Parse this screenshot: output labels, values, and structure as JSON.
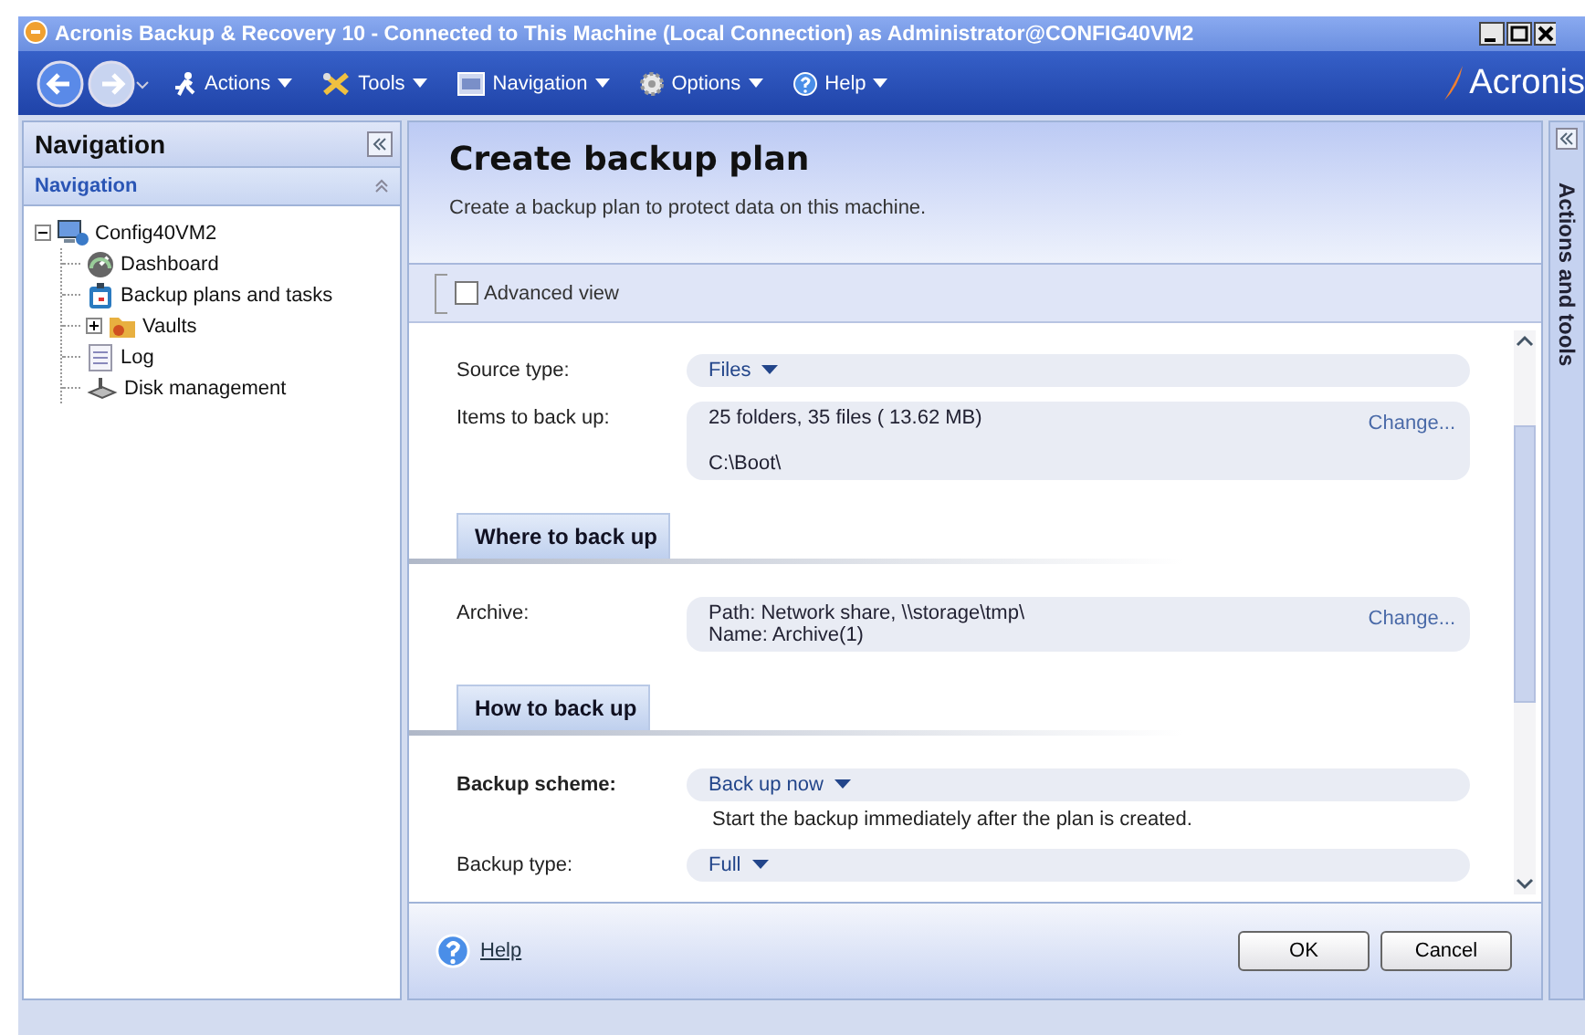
{
  "window": {
    "title": "Acronis Backup & Recovery 10 - Connected to This Machine (Local Connection) as Administrator@CONFIG40VM2"
  },
  "toolbar": {
    "items": [
      {
        "label": "Actions"
      },
      {
        "label": "Tools"
      },
      {
        "label": "Navigation"
      },
      {
        "label": "Options"
      },
      {
        "label": "Help"
      }
    ],
    "brand": "Acronis"
  },
  "navigation": {
    "title": "Navigation",
    "section": "Navigation",
    "tree": [
      {
        "label": "Config40VM2",
        "expanded": true,
        "children": [
          {
            "label": "Dashboard"
          },
          {
            "label": "Backup plans and tasks"
          },
          {
            "label": "Vaults",
            "expanded": false
          },
          {
            "label": "Log"
          },
          {
            "label": "Disk management"
          }
        ]
      }
    ]
  },
  "plan": {
    "title": "Create backup plan",
    "subtitle": "Create a backup plan to protect data on this machine.",
    "advanced_view": {
      "label": "Advanced view",
      "checked": false
    },
    "rows": [
      {
        "kind": "dropdown",
        "label": "Source type:",
        "value": "Files"
      },
      {
        "kind": "info",
        "label": "Items to back up:",
        "lines": [
          "25 folders, 35 files ( 13.62 MB)",
          "C:\\Boot\\"
        ],
        "link": "Change..."
      },
      {
        "kind": "section",
        "label": "Where to back up"
      },
      {
        "kind": "info",
        "label": "Archive:",
        "lines": [
          "Path: Network share, \\\\storage\\tmp\\",
          "Name: Archive(1)"
        ],
        "link": "Change..."
      },
      {
        "kind": "section",
        "label": "How to back up"
      },
      {
        "kind": "dropdown",
        "label": "Backup scheme:",
        "bold": true,
        "value": "Back up now",
        "note": "Start the backup immediately after the plan is created."
      },
      {
        "kind": "dropdown",
        "label": "Backup type:",
        "value": "Full"
      }
    ],
    "help": "Help",
    "buttons": [
      "OK",
      "Cancel"
    ]
  },
  "side_panel": {
    "title": "Actions and tools"
  }
}
